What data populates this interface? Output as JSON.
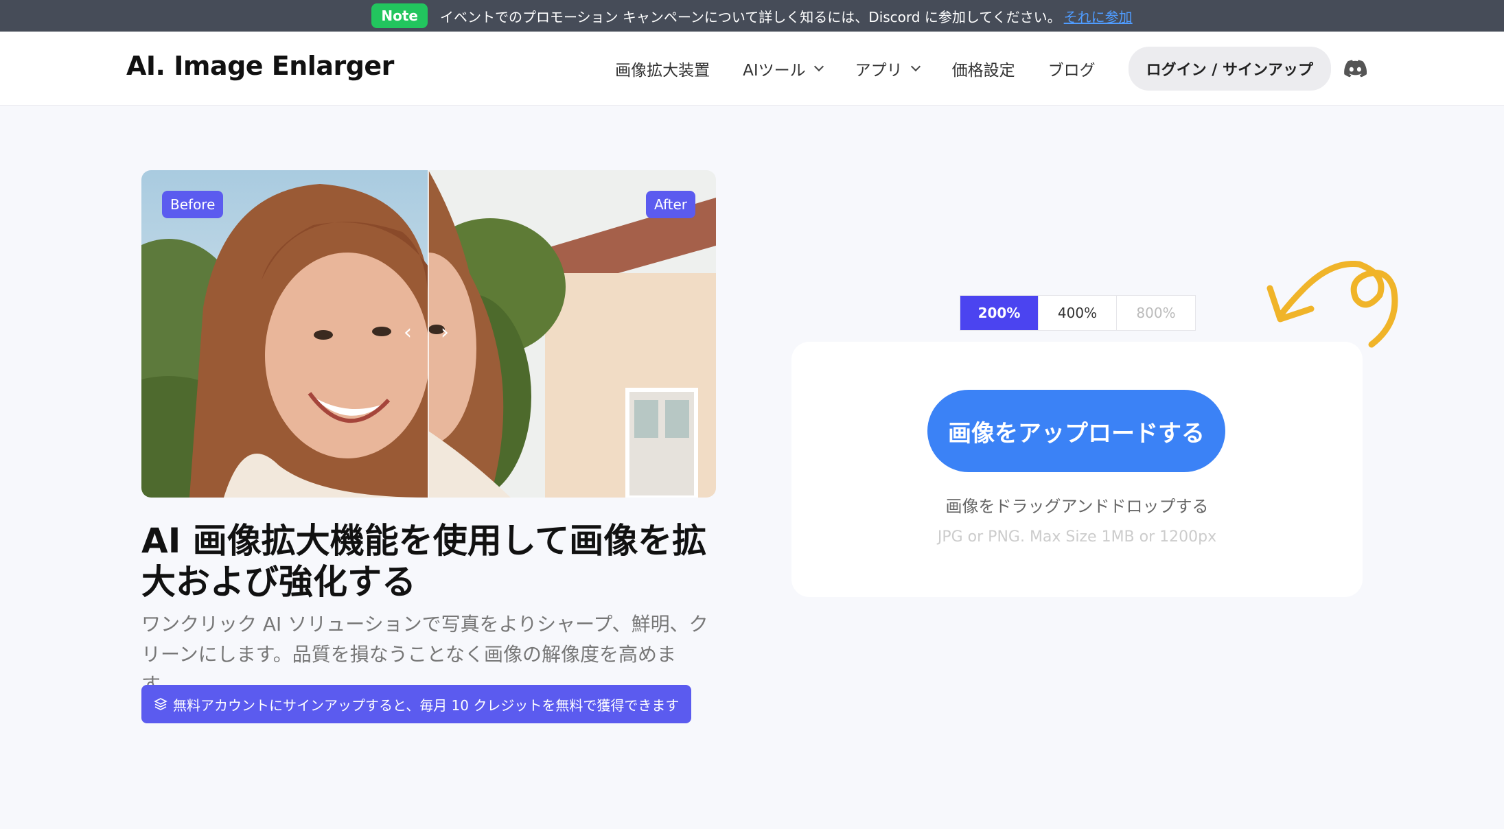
{
  "topbar": {
    "note_label": "Note",
    "message": "イベントでのプロモーション キャンペーンについて詳しく知るには、Discord に参加してください。",
    "link_text": "それに参加"
  },
  "header": {
    "logo": "AI. Image Enlarger",
    "nav": [
      {
        "label": "画像拡大装置",
        "dropdown": false
      },
      {
        "label": "AIツール",
        "dropdown": true
      },
      {
        "label": "アプリ",
        "dropdown": true
      },
      {
        "label": "価格設定",
        "dropdown": false
      },
      {
        "label": "ブログ",
        "dropdown": false
      }
    ],
    "login_label": "ログイン / サインアップ",
    "discord_icon": "discord-icon"
  },
  "compare": {
    "before_label": "Before",
    "after_label": "After",
    "prev_glyph": "‹",
    "next_glyph": "›"
  },
  "hero": {
    "title": "AI 画像拡大機能を使用して画像を拡大および強化する",
    "subtitle": "ワンクリック AI ソリューションで写真をよりシャープ、鮮明、クリーンにします。品質を損なうことなく画像の解像度を高めます。",
    "promo": "無料アカウントにサインアップすると、毎月 10 クレジットを無料で獲得できます"
  },
  "scale": {
    "options": [
      "200%",
      "400%",
      "800%"
    ],
    "selected": "200%"
  },
  "upload": {
    "button_label": "画像をアップロードする",
    "drag_text": "画像をドラッグアンドドロップする",
    "limit_text": "JPG or PNG. Max Size 1MB or 1200px"
  },
  "colors": {
    "accent": "#5b5bef",
    "upload_button": "#3b82f6",
    "note_badge": "#22c55e",
    "topbar_bg": "#464c58",
    "doodle": "#f0b429"
  }
}
